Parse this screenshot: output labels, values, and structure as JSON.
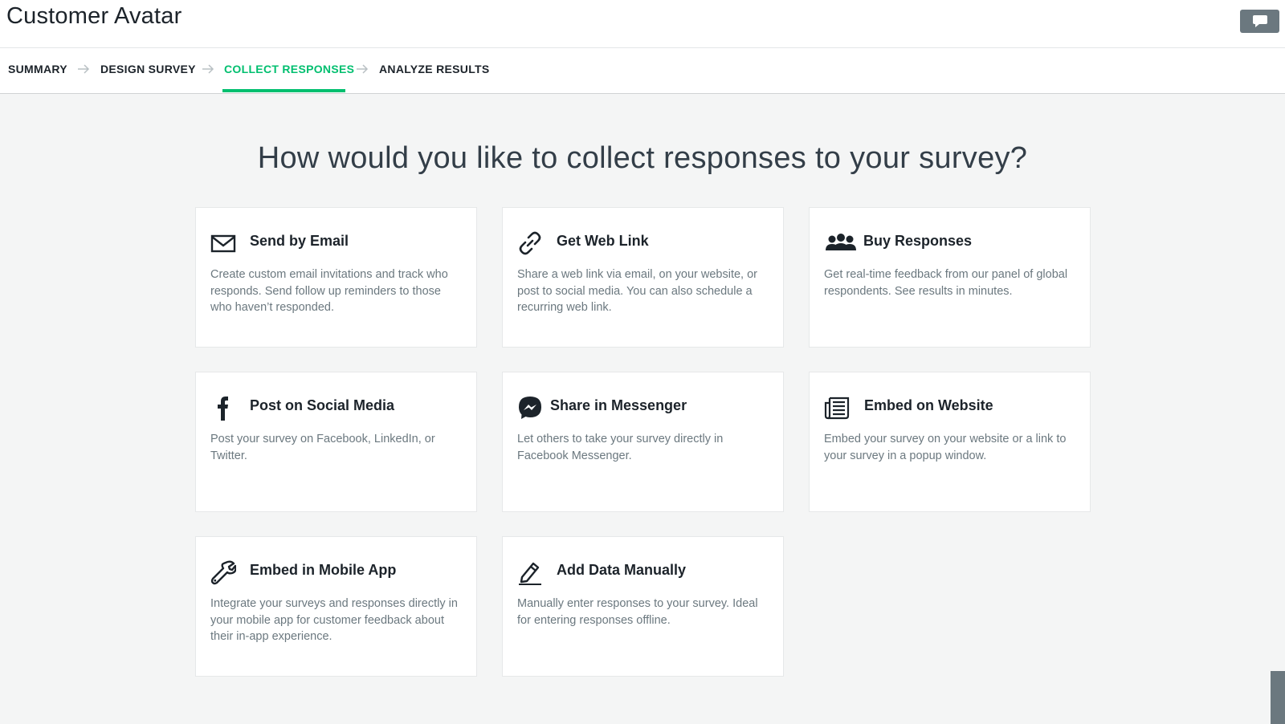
{
  "survey": {
    "title": "Customer Avatar"
  },
  "steps": [
    {
      "label": "SUMMARY"
    },
    {
      "label": "DESIGN SURVEY"
    },
    {
      "label": "COLLECT RESPONSES"
    },
    {
      "label": "ANALYZE RESULTS"
    }
  ],
  "active_step": "COLLECT RESPONSES",
  "headline": "How would you like to collect responses to your survey?",
  "collectors": [
    {
      "title": "Send by Email",
      "icon": "envelope-icon",
      "description": "Create custom email invitations and track who responds. Send follow up reminders to those who haven’t responded."
    },
    {
      "title": "Get Web Link",
      "icon": "link-icon",
      "description": "Share a web link via email, on your website, or post to social media. You can also schedule a recurring web link."
    },
    {
      "title": "Buy Responses",
      "icon": "people-group-icon",
      "description": "Get real-time feedback from our panel of global respondents. See results in minutes."
    },
    {
      "title": "Post on Social Media",
      "icon": "facebook-icon",
      "description": "Post your survey on Facebook, LinkedIn, or Twitter."
    },
    {
      "title": "Share in Messenger",
      "icon": "messenger-icon",
      "description": "Let others to take your survey directly in Facebook Messenger."
    },
    {
      "title": "Embed on Website",
      "icon": "newspaper-icon",
      "description": "Embed your survey on your website or a link to your survey in a popup window."
    },
    {
      "title": "Embed in Mobile App",
      "icon": "wrench-icon",
      "description": "Integrate your surveys and responses directly in your mobile app for customer feedback about their in-app experience."
    },
    {
      "title": "Add Data Manually",
      "icon": "pencil-icon",
      "description": "Manually enter responses to your survey. Ideal for entering responses offline."
    }
  ],
  "colors": {
    "accent": "#00bf6f",
    "page_background": "#f4f5f5",
    "button_gray": "#6b787f",
    "text_dark": "#1c232a",
    "text_muted": "#6b787f"
  },
  "icons": {
    "feedback": "speech-bubble-icon",
    "step_separator": "arrow-right-icon"
  }
}
